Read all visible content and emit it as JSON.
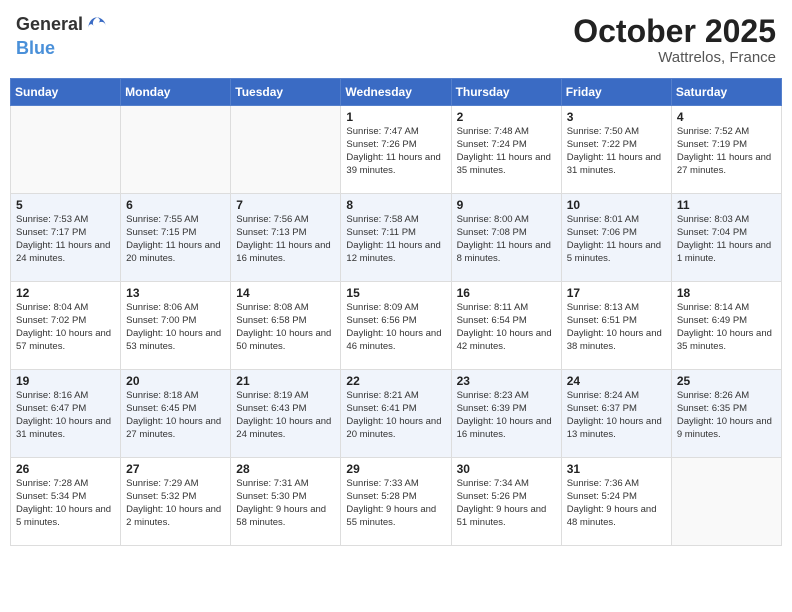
{
  "header": {
    "logo_general": "General",
    "logo_blue": "Blue",
    "month": "October 2025",
    "location": "Wattrelos, France"
  },
  "weekdays": [
    "Sunday",
    "Monday",
    "Tuesday",
    "Wednesday",
    "Thursday",
    "Friday",
    "Saturday"
  ],
  "weeks": [
    [
      {
        "day": "",
        "sunrise": "",
        "sunset": "",
        "daylight": ""
      },
      {
        "day": "",
        "sunrise": "",
        "sunset": "",
        "daylight": ""
      },
      {
        "day": "",
        "sunrise": "",
        "sunset": "",
        "daylight": ""
      },
      {
        "day": "1",
        "sunrise": "Sunrise: 7:47 AM",
        "sunset": "Sunset: 7:26 PM",
        "daylight": "Daylight: 11 hours and 39 minutes."
      },
      {
        "day": "2",
        "sunrise": "Sunrise: 7:48 AM",
        "sunset": "Sunset: 7:24 PM",
        "daylight": "Daylight: 11 hours and 35 minutes."
      },
      {
        "day": "3",
        "sunrise": "Sunrise: 7:50 AM",
        "sunset": "Sunset: 7:22 PM",
        "daylight": "Daylight: 11 hours and 31 minutes."
      },
      {
        "day": "4",
        "sunrise": "Sunrise: 7:52 AM",
        "sunset": "Sunset: 7:19 PM",
        "daylight": "Daylight: 11 hours and 27 minutes."
      }
    ],
    [
      {
        "day": "5",
        "sunrise": "Sunrise: 7:53 AM",
        "sunset": "Sunset: 7:17 PM",
        "daylight": "Daylight: 11 hours and 24 minutes."
      },
      {
        "day": "6",
        "sunrise": "Sunrise: 7:55 AM",
        "sunset": "Sunset: 7:15 PM",
        "daylight": "Daylight: 11 hours and 20 minutes."
      },
      {
        "day": "7",
        "sunrise": "Sunrise: 7:56 AM",
        "sunset": "Sunset: 7:13 PM",
        "daylight": "Daylight: 11 hours and 16 minutes."
      },
      {
        "day": "8",
        "sunrise": "Sunrise: 7:58 AM",
        "sunset": "Sunset: 7:11 PM",
        "daylight": "Daylight: 11 hours and 12 minutes."
      },
      {
        "day": "9",
        "sunrise": "Sunrise: 8:00 AM",
        "sunset": "Sunset: 7:08 PM",
        "daylight": "Daylight: 11 hours and 8 minutes."
      },
      {
        "day": "10",
        "sunrise": "Sunrise: 8:01 AM",
        "sunset": "Sunset: 7:06 PM",
        "daylight": "Daylight: 11 hours and 5 minutes."
      },
      {
        "day": "11",
        "sunrise": "Sunrise: 8:03 AM",
        "sunset": "Sunset: 7:04 PM",
        "daylight": "Daylight: 11 hours and 1 minute."
      }
    ],
    [
      {
        "day": "12",
        "sunrise": "Sunrise: 8:04 AM",
        "sunset": "Sunset: 7:02 PM",
        "daylight": "Daylight: 10 hours and 57 minutes."
      },
      {
        "day": "13",
        "sunrise": "Sunrise: 8:06 AM",
        "sunset": "Sunset: 7:00 PM",
        "daylight": "Daylight: 10 hours and 53 minutes."
      },
      {
        "day": "14",
        "sunrise": "Sunrise: 8:08 AM",
        "sunset": "Sunset: 6:58 PM",
        "daylight": "Daylight: 10 hours and 50 minutes."
      },
      {
        "day": "15",
        "sunrise": "Sunrise: 8:09 AM",
        "sunset": "Sunset: 6:56 PM",
        "daylight": "Daylight: 10 hours and 46 minutes."
      },
      {
        "day": "16",
        "sunrise": "Sunrise: 8:11 AM",
        "sunset": "Sunset: 6:54 PM",
        "daylight": "Daylight: 10 hours and 42 minutes."
      },
      {
        "day": "17",
        "sunrise": "Sunrise: 8:13 AM",
        "sunset": "Sunset: 6:51 PM",
        "daylight": "Daylight: 10 hours and 38 minutes."
      },
      {
        "day": "18",
        "sunrise": "Sunrise: 8:14 AM",
        "sunset": "Sunset: 6:49 PM",
        "daylight": "Daylight: 10 hours and 35 minutes."
      }
    ],
    [
      {
        "day": "19",
        "sunrise": "Sunrise: 8:16 AM",
        "sunset": "Sunset: 6:47 PM",
        "daylight": "Daylight: 10 hours and 31 minutes."
      },
      {
        "day": "20",
        "sunrise": "Sunrise: 8:18 AM",
        "sunset": "Sunset: 6:45 PM",
        "daylight": "Daylight: 10 hours and 27 minutes."
      },
      {
        "day": "21",
        "sunrise": "Sunrise: 8:19 AM",
        "sunset": "Sunset: 6:43 PM",
        "daylight": "Daylight: 10 hours and 24 minutes."
      },
      {
        "day": "22",
        "sunrise": "Sunrise: 8:21 AM",
        "sunset": "Sunset: 6:41 PM",
        "daylight": "Daylight: 10 hours and 20 minutes."
      },
      {
        "day": "23",
        "sunrise": "Sunrise: 8:23 AM",
        "sunset": "Sunset: 6:39 PM",
        "daylight": "Daylight: 10 hours and 16 minutes."
      },
      {
        "day": "24",
        "sunrise": "Sunrise: 8:24 AM",
        "sunset": "Sunset: 6:37 PM",
        "daylight": "Daylight: 10 hours and 13 minutes."
      },
      {
        "day": "25",
        "sunrise": "Sunrise: 8:26 AM",
        "sunset": "Sunset: 6:35 PM",
        "daylight": "Daylight: 10 hours and 9 minutes."
      }
    ],
    [
      {
        "day": "26",
        "sunrise": "Sunrise: 7:28 AM",
        "sunset": "Sunset: 5:34 PM",
        "daylight": "Daylight: 10 hours and 5 minutes."
      },
      {
        "day": "27",
        "sunrise": "Sunrise: 7:29 AM",
        "sunset": "Sunset: 5:32 PM",
        "daylight": "Daylight: 10 hours and 2 minutes."
      },
      {
        "day": "28",
        "sunrise": "Sunrise: 7:31 AM",
        "sunset": "Sunset: 5:30 PM",
        "daylight": "Daylight: 9 hours and 58 minutes."
      },
      {
        "day": "29",
        "sunrise": "Sunrise: 7:33 AM",
        "sunset": "Sunset: 5:28 PM",
        "daylight": "Daylight: 9 hours and 55 minutes."
      },
      {
        "day": "30",
        "sunrise": "Sunrise: 7:34 AM",
        "sunset": "Sunset: 5:26 PM",
        "daylight": "Daylight: 9 hours and 51 minutes."
      },
      {
        "day": "31",
        "sunrise": "Sunrise: 7:36 AM",
        "sunset": "Sunset: 5:24 PM",
        "daylight": "Daylight: 9 hours and 48 minutes."
      },
      {
        "day": "",
        "sunrise": "",
        "sunset": "",
        "daylight": ""
      }
    ]
  ]
}
